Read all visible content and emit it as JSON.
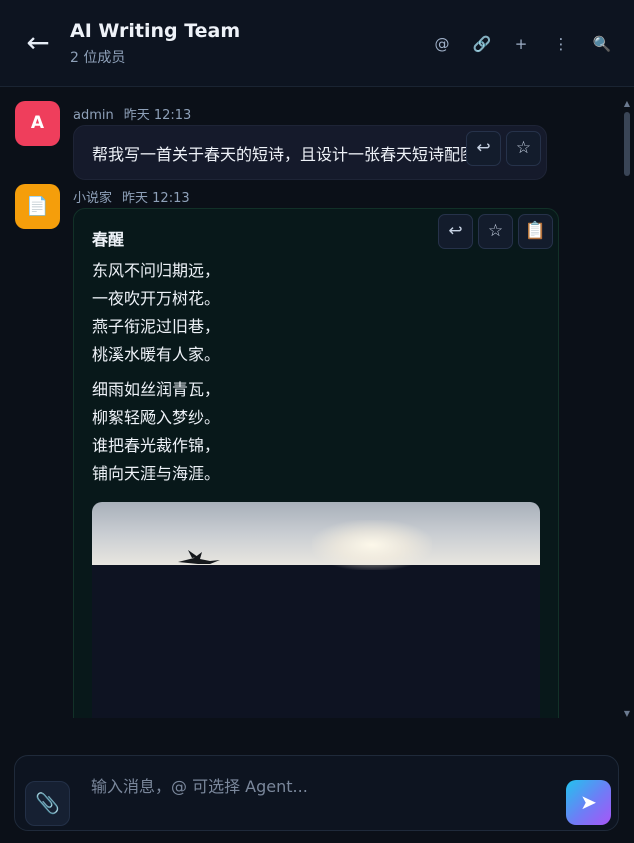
{
  "header": {
    "back_icon": "←",
    "title": "AI Writing Team",
    "subtitle": "2 位成员",
    "icons": {
      "mention": "@",
      "link": "🔗",
      "add": "+",
      "more": "⋮",
      "search": "🔍"
    }
  },
  "messages": [
    {
      "avatar": "A",
      "avatar_color": "#ef3e5c",
      "sender": "admin",
      "time": "昨天 12:13",
      "text": "帮我写一首关于春天的短诗，且设计一张春天短诗配图"
    },
    {
      "avatar": "📄",
      "avatar_color": "#f59e0b",
      "sender": "小说家",
      "time": "昨天 12:13",
      "poem_title": "春醒",
      "stanza1": [
        "东风不问归期远，",
        "一夜吹开万树花。",
        "燕子衔泥过旧巷，",
        "桃溪水暖有人家。"
      ],
      "stanza2": [
        "细雨如丝润青瓦，",
        "柳絮轻飏入梦纱。",
        "谁把春光裁作锦，",
        "铺向天涯与海涯。"
      ]
    }
  ],
  "actions": {
    "reply_icon": "↩",
    "star_icon": "☆",
    "copy_icon": "📋"
  },
  "composer": {
    "attach_icon": "📎",
    "placeholder": "输入消息，@ 可选择 Agent...",
    "send_icon": "➤"
  },
  "colors": {
    "background": "#0b1018",
    "agent_bubble": "#08181a",
    "user_bubble": "#151a2b"
  }
}
